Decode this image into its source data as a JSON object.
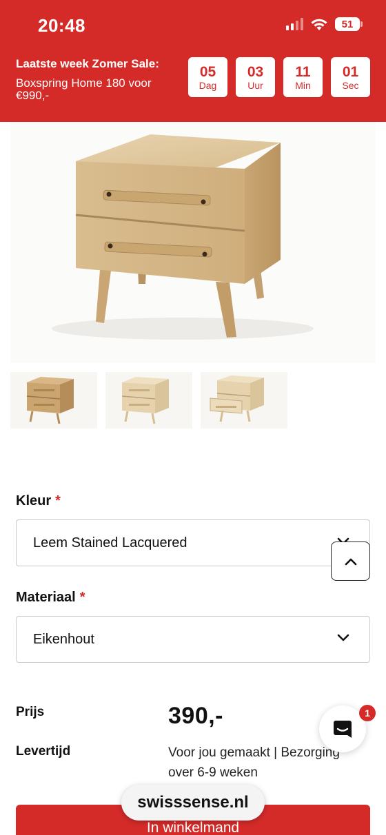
{
  "status_bar": {
    "time": "20:48",
    "battery": "51",
    "icons": [
      "cellular-signal-icon",
      "wifi-icon",
      "battery-icon"
    ]
  },
  "promo": {
    "title": "Laatste week Zomer Sale:",
    "subtitle": "Boxspring Home 180 voor €990,-",
    "countdown": [
      {
        "value": "05",
        "unit": "Dag"
      },
      {
        "value": "03",
        "unit": "Uur"
      },
      {
        "value": "11",
        "unit": "Min"
      },
      {
        "value": "01",
        "unit": "Sec"
      }
    ]
  },
  "product": {
    "fields": [
      {
        "label": "Kleur",
        "required": "*",
        "value": "Leem Stained Lacquered"
      },
      {
        "label": "Materiaal",
        "required": "*",
        "value": "Eikenhout"
      }
    ],
    "price_label": "Prijs",
    "price": "390,-",
    "delivery_label": "Levertijd",
    "delivery": "Voor jou gemaakt | Bezorging over 6-9 weken",
    "add_to_cart": "In winkelmand"
  },
  "chat": {
    "badge": "1"
  },
  "browser": {
    "url": "swisssense.nl"
  },
  "colors": {
    "brand_red": "#d42b29",
    "wood": "#d9bb8c"
  }
}
